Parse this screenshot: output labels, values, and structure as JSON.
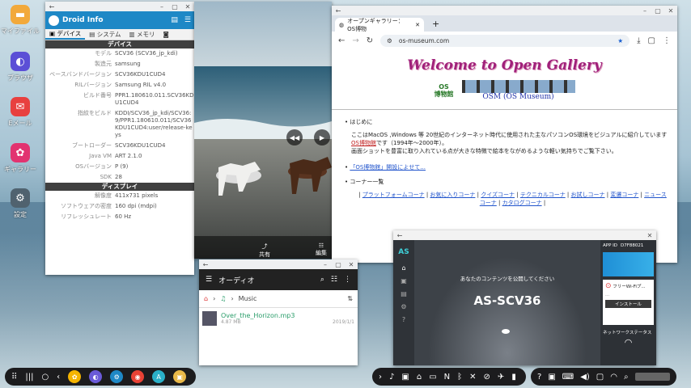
{
  "desktop": [
    {
      "label": "マイファイル",
      "color": "#f2a93b",
      "glyph": "▬"
    },
    {
      "label": "ブラウザ",
      "color": "#5b4fd6",
      "glyph": "◐"
    },
    {
      "label": "Eメール",
      "color": "#e8403f",
      "glyph": "✉"
    },
    {
      "label": "ギャラリー",
      "color": "#e23370",
      "glyph": "✿"
    },
    {
      "label": "設定",
      "color": "#50626f",
      "glyph": "⚙"
    }
  ],
  "droid": {
    "title": "Droid Info",
    "tabs": [
      "デバイス",
      "システム",
      "メモリ"
    ],
    "device_header": "デバイス",
    "device": [
      {
        "k": "モデル",
        "v": "SCV36 (SCV36_jp_kdi)"
      },
      {
        "k": "製造元",
        "v": "samsung"
      },
      {
        "k": "ベースバンドバージョン",
        "v": "SCV36KDU1CUD4"
      },
      {
        "k": "RILバージョン",
        "v": "Samsung RIL v4.0"
      },
      {
        "k": "ビルド番号",
        "v": "PPR1.180610.011.SCV36KDU1CUD4"
      },
      {
        "k": "指紋をビルド",
        "v": "KDDI/SCV36_jp_kdi/SCV36:9/PPR1.180610.011/SCV36KDU1CUD4:user/release-keys"
      },
      {
        "k": "ブートローダー",
        "v": "SCV36KDU1CUD4"
      },
      {
        "k": "Java VM",
        "v": "ART 2.1.0"
      },
      {
        "k": "OSバージョン",
        "v": "P (9)"
      },
      {
        "k": "SDK",
        "v": "28"
      }
    ],
    "display_header": "ディスプレイ",
    "display": [
      {
        "k": "解像度",
        "v": "411x731 pixels"
      },
      {
        "k": "ソフトウェアの密度",
        "v": "160 dpi (mdpi)"
      },
      {
        "k": "リフレッシュレート",
        "v": "60 Hz"
      }
    ]
  },
  "gallery": {
    "share": "共有",
    "edit": "編集"
  },
  "chrome": {
    "tab_title": "オープンギャラリー：OS博物",
    "url": "os-museum.com",
    "welcome": "Welcome to Open Gallery",
    "logo_text": "OSM (OS Museum)",
    "items": [
      {
        "head": "はじめに",
        "body": "ここはMacOS ,Windows 等 20世紀のインターネット時代に使用された主なパソコンOS環境をビジュアルに紹介しています",
        "link": "OS博物館",
        "body2": "です（1994年〜2000年）。",
        "body3": "画面ショットを豊富に取り入れている点が大きな特徴で絵本をながめるような軽い気持ちでご覧下さい。"
      },
      {
        "link": "「OS博物館」開設によせて..."
      },
      {
        "head": "コーナー一覧"
      }
    ],
    "corners": [
      "プラットフォームコーナ",
      "お気に入りコーナ",
      "クイズコーナ",
      "テクニカルコーナ",
      "お試しコーナ",
      "変遷コーナ",
      "ニュースコーナ",
      "カタログコーナ"
    ]
  },
  "audio": {
    "title": "オーディオ",
    "folder": "Music",
    "file": "Over_the_Horizon.mp3",
    "size": "4.87 MB",
    "date": "2019/1/1"
  },
  "as": {
    "share_text": "あなたのコンテンツを公開してください",
    "device": "AS-SCV36",
    "install": "インストール",
    "network": "ネットワークステータス",
    "free": "フリーWi-Fiプ...",
    "top1": "APP ID",
    "top2": "D7F88021"
  }
}
